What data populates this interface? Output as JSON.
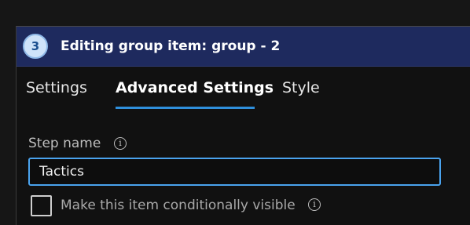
{
  "panel": {
    "step_number": "3",
    "title": "Editing group item: group - 2"
  },
  "tabs": [
    {
      "label": "Settings",
      "active": false
    },
    {
      "label": "Advanced Settings",
      "active": true
    },
    {
      "label": "Style",
      "active": false
    }
  ],
  "step_name": {
    "label": "Step name",
    "value": "Tactics",
    "info_icon": "info-icon"
  },
  "conditional_visibility": {
    "label": "Make this item conditionally visible",
    "checked": false,
    "info_icon": "info-icon"
  },
  "colors": {
    "header_bg": "#1e2a5e",
    "accent": "#2f8fdc",
    "input_border": "#4aa3ee",
    "background": "#111111"
  }
}
